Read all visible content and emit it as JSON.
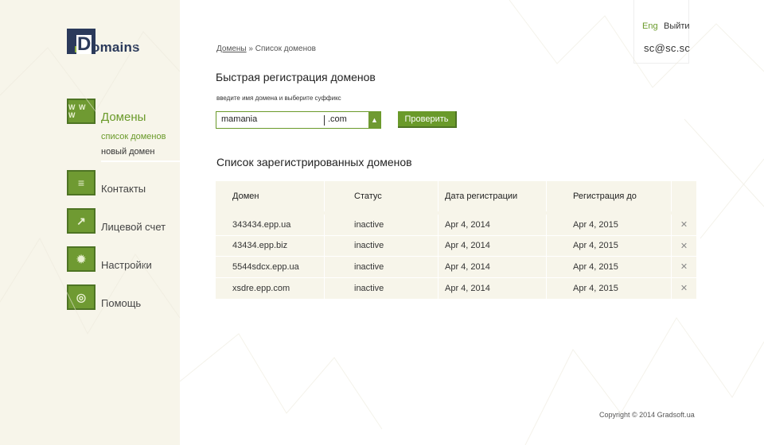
{
  "logo": {
    "letter": "D",
    "text": "omains"
  },
  "sidebar": {
    "items": [
      {
        "label": "Домены",
        "icon": "www-icon",
        "icon_text": "W W W"
      },
      {
        "label": "Контакты",
        "icon": "contacts-list-icon",
        "icon_text": "≡"
      },
      {
        "label": "Лицевой счет",
        "icon": "account-chart-icon",
        "icon_text": "↗"
      },
      {
        "label": "Настройки",
        "icon": "gear-icon",
        "icon_text": "✹"
      },
      {
        "label": "Помощь",
        "icon": "lifebuoy-icon",
        "icon_text": "◎"
      }
    ],
    "subitems": [
      {
        "label": "список доменов"
      },
      {
        "label": "новый домен"
      }
    ]
  },
  "header": {
    "breadcrumb_home": "Домены",
    "breadcrumb_sep": " » ",
    "breadcrumb_current": "Список доменов",
    "lang": "Eng",
    "logout": "Выйти",
    "user": "sc@sc.sc"
  },
  "quick_reg": {
    "title": "Быстрая регистрация доменов",
    "hint": "введите имя домена и выберите суффикс",
    "input_value": "mamania",
    "suffix": ".com",
    "check_button": "Проверить"
  },
  "domains": {
    "title": "Список зарегистрированных доменов",
    "columns": [
      "Домен",
      "Статус",
      "Дата регистрации",
      "Регистрация до"
    ],
    "rows": [
      {
        "domain": "343434.epp.ua",
        "status": "inactive",
        "reg_date": "Apr 4, 2014",
        "expires": "Apr 4, 2015"
      },
      {
        "domain": "43434.epp.biz",
        "status": "inactive",
        "reg_date": "Apr 4, 2014",
        "expires": "Apr 4, 2015"
      },
      {
        "domain": "5544sdcx.epp.ua",
        "status": "inactive",
        "reg_date": "Apr 4, 2014",
        "expires": "Apr 4, 2015"
      },
      {
        "domain": "xsdre.epp.com",
        "status": "inactive",
        "reg_date": "Apr 4, 2014",
        "expires": "Apr 4, 2015"
      }
    ],
    "delete_glyph": "✕"
  },
  "footer": {
    "copyright": "Copyright ©  2014 Gradsoft.ua"
  },
  "colors": {
    "accent": "#6a9a2a",
    "sidebar_bg": "#f7f5ea",
    "logo_dark": "#2b3a5b"
  }
}
